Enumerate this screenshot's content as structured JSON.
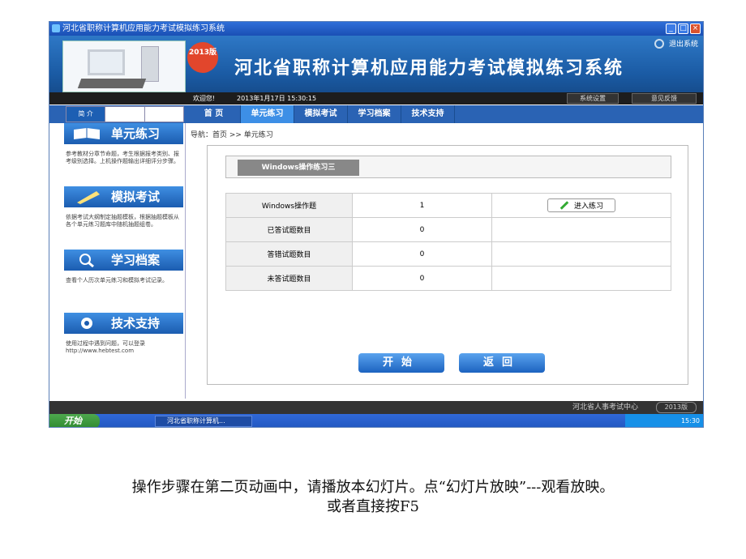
{
  "window": {
    "title": "河北省职称计算机应用能力考试模拟练习系统"
  },
  "header": {
    "badge": "2013版",
    "title": "河北省职称计算机应用能力考试模拟练习系统",
    "exit_label": "退出系统",
    "welcome": "欢迎您!",
    "datetime": "2013年1月17日 15:30:15",
    "settings_label": "系统设置",
    "feedback_label": "意见反馈"
  },
  "left_tabs": [
    "简 介",
    "",
    ""
  ],
  "nav": [
    "首 页",
    "单元练习",
    "模拟考试",
    "学习档案",
    "技术支持"
  ],
  "sidebar": [
    {
      "title": "单元练习",
      "desc": "参考教材分章节命题，考生根据报考类别、报考级别选择。上机操作题输出详细评分步骤。"
    },
    {
      "title": "模拟考试",
      "desc": "依据考试大纲制定抽题模板，根据抽题模板从各个单元练习题库中随机抽题组卷。"
    },
    {
      "title": "学习档案",
      "desc": "查看个人历次单元练习和模拟考试记录。"
    },
    {
      "title": "技术支持",
      "desc": "使用过程中遇到问题，可以登录http://www.hebtest.com"
    }
  ],
  "breadcrumb": "导航：首页 >> 单元练习",
  "practice": {
    "tab": "Windows操作练习三",
    "rows": [
      {
        "label": "Windows操作题",
        "value": "1"
      },
      {
        "label": "已答试题数目",
        "value": "0"
      },
      {
        "label": "答错试题数目",
        "value": "0"
      },
      {
        "label": "未答试题数目",
        "value": "0"
      }
    ],
    "enter_label": "进入练习",
    "start_label": "开始",
    "back_label": "返回"
  },
  "footer": {
    "org": "河北省人事考试中心",
    "version": "2013版"
  },
  "taskbar": {
    "start": "开始",
    "task": "河北省职称计算机...",
    "clock": "15:30"
  },
  "caption": {
    "line1": "操作步骤在第二页动画中，请播放本幻灯片。点“幻灯片放映”---观看放映。",
    "line2": "或者直接按F5"
  }
}
